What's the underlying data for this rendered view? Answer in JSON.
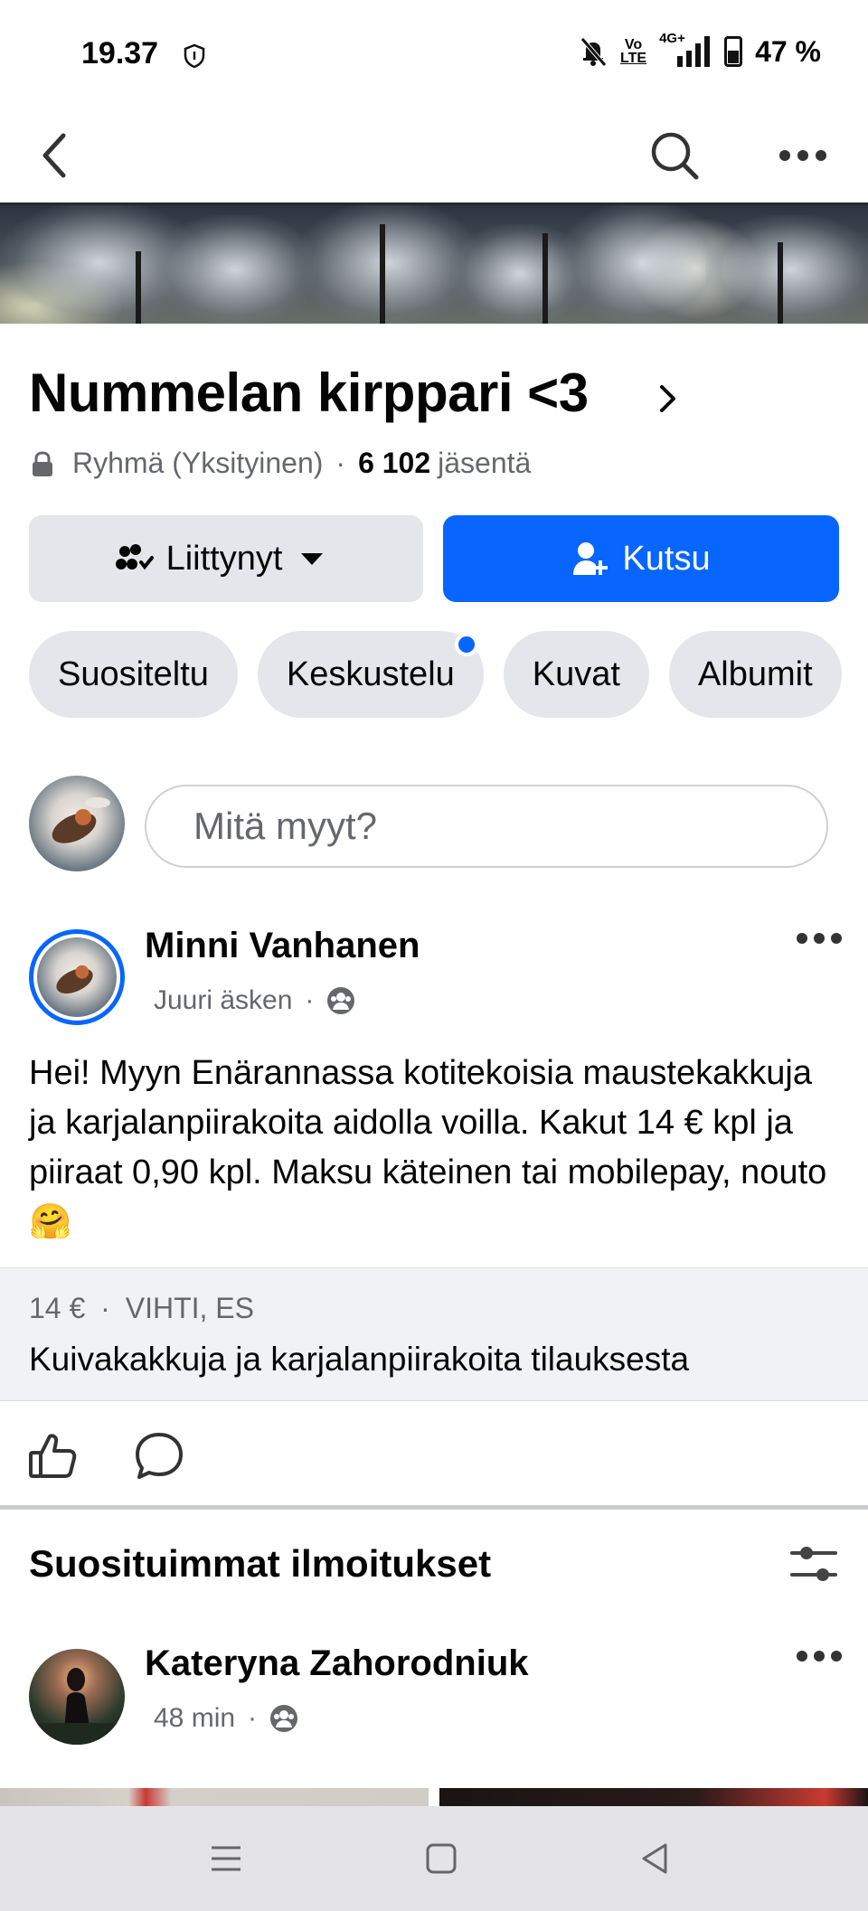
{
  "status": {
    "time": "19.37",
    "network_top": "Vo",
    "network_bottom": "LTE",
    "signal": "4G+",
    "battery": "47 %"
  },
  "nav": {
    "back_icon": "chevron-left-icon",
    "search_icon": "search-icon",
    "more_icon": "more-horizontal-icon"
  },
  "group": {
    "name": "Nummelan kirppari <3",
    "type": "Ryhmä (Yksityinen)",
    "separator": "·",
    "members_count": "6 102",
    "members_label": "jäsentä"
  },
  "buttons": {
    "joined_label": "Liittynyt",
    "invite_label": "Kutsu"
  },
  "tabs": [
    {
      "label": "Suositeltu"
    },
    {
      "label": "Keskustelu",
      "badge": true
    },
    {
      "label": "Kuvat"
    },
    {
      "label": "Albumit"
    }
  ],
  "composer": {
    "placeholder": "Mitä myyt?"
  },
  "post": {
    "author": "Minni Vanhanen",
    "time": "Juuri äsken",
    "separator": "·",
    "text": "Hei! Myyn Enärannassa kotitekoisia maustekakkuja ja karjalanpiirakoita aidolla voilla. Kakut 14 € kpl ja piiraat 0,90 kpl. Maksu käteinen tai mobilepay, nouto",
    "emoji": "🤗",
    "listing": {
      "price": "14 €",
      "separator": "·",
      "location": "VIHTI, ES",
      "title": "Kuivakakkuja ja karjalanpiirakoita tilauksesta"
    }
  },
  "section": {
    "title": "Suosituimmat ilmoitukset"
  },
  "post2": {
    "author": "Kateryna Zahorodniuk",
    "time": "48 min",
    "separator": "·"
  },
  "colors": {
    "accent": "#0866ff",
    "chip_bg": "#e4e6eb",
    "secondary_text": "#65676b"
  }
}
